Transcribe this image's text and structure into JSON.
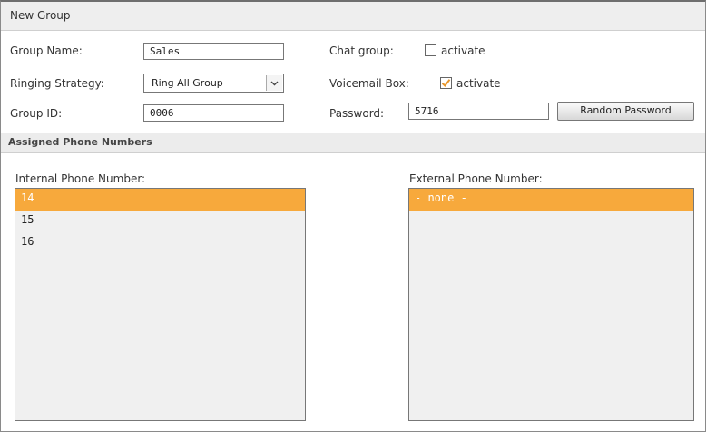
{
  "header": {
    "title": "New Group"
  },
  "form": {
    "group_name": {
      "label": "Group Name:",
      "value": "Sales"
    },
    "ringing_strategy": {
      "label": "Ringing Strategy:",
      "value": "Ring All Group"
    },
    "group_id": {
      "label": "Group ID:",
      "value": "0006"
    },
    "chat_group": {
      "label": "Chat group:",
      "option": "activate",
      "checked": false
    },
    "voicemail_box": {
      "label": "Voicemail Box:",
      "option": "activate",
      "checked": true
    },
    "password": {
      "label": "Password:",
      "value": "5716"
    },
    "random_password_button": "Random Password"
  },
  "assigned": {
    "title": "Assigned Phone Numbers",
    "internal": {
      "label": "Internal Phone Number:",
      "options": [
        "14",
        "15",
        "16"
      ],
      "selected_index": 0
    },
    "external": {
      "label": "External Phone Number:",
      "options": [
        "- none -"
      ],
      "selected_index": 0
    }
  },
  "colors": {
    "selection": "#f7a93c",
    "checkmark": "#e8962a"
  },
  "icons": {
    "dropdown": "chevron-down-icon",
    "check": "checkmark-icon"
  }
}
